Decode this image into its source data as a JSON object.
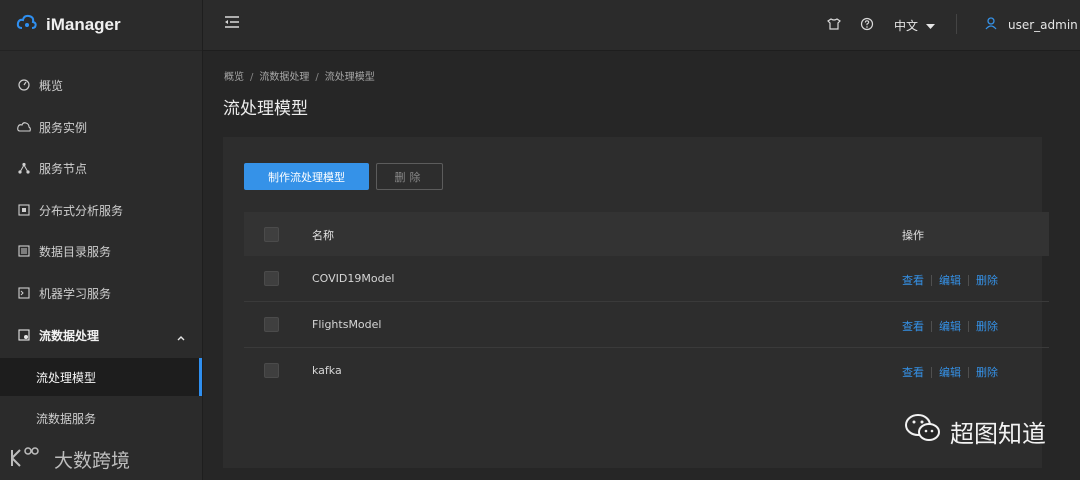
{
  "app": {
    "name": "iManager"
  },
  "sidebar": {
    "items": [
      {
        "label": "概览",
        "icon": "dashboard-icon"
      },
      {
        "label": "服务实例",
        "icon": "cloud-icon"
      },
      {
        "label": "服务节点",
        "icon": "nodes-icon"
      },
      {
        "label": "分布式分析服务",
        "icon": "square-icon"
      },
      {
        "label": "数据目录服务",
        "icon": "catalog-icon"
      },
      {
        "label": "机器学习服务",
        "icon": "terminal-icon"
      },
      {
        "label": "流数据处理",
        "icon": "stream-icon"
      }
    ],
    "sub_items": [
      {
        "label": "流处理模型",
        "active": true
      },
      {
        "label": "流数据服务",
        "active": false
      }
    ]
  },
  "topbar": {
    "language": "中文",
    "user": "user_admin"
  },
  "breadcrumb": [
    "概览",
    "流数据处理",
    "流处理模型"
  ],
  "page": {
    "title": "流处理模型"
  },
  "toolbar": {
    "create_label": "制作流处理模型",
    "delete_label": "删除"
  },
  "table": {
    "headers": {
      "name": "名称",
      "actions": "操作"
    },
    "rows": [
      {
        "name": "COVID19Model"
      },
      {
        "name": "FlightsModel"
      },
      {
        "name": "kafka"
      }
    ],
    "actions": {
      "view": "查看",
      "edit": "编辑",
      "delete": "删除"
    }
  },
  "watermarks": {
    "wechat": "超图知道",
    "bottom": "大数跨境"
  },
  "colors": {
    "accent": "#3592e8",
    "background": "#262626",
    "sidebar": "#2b2b2b"
  }
}
